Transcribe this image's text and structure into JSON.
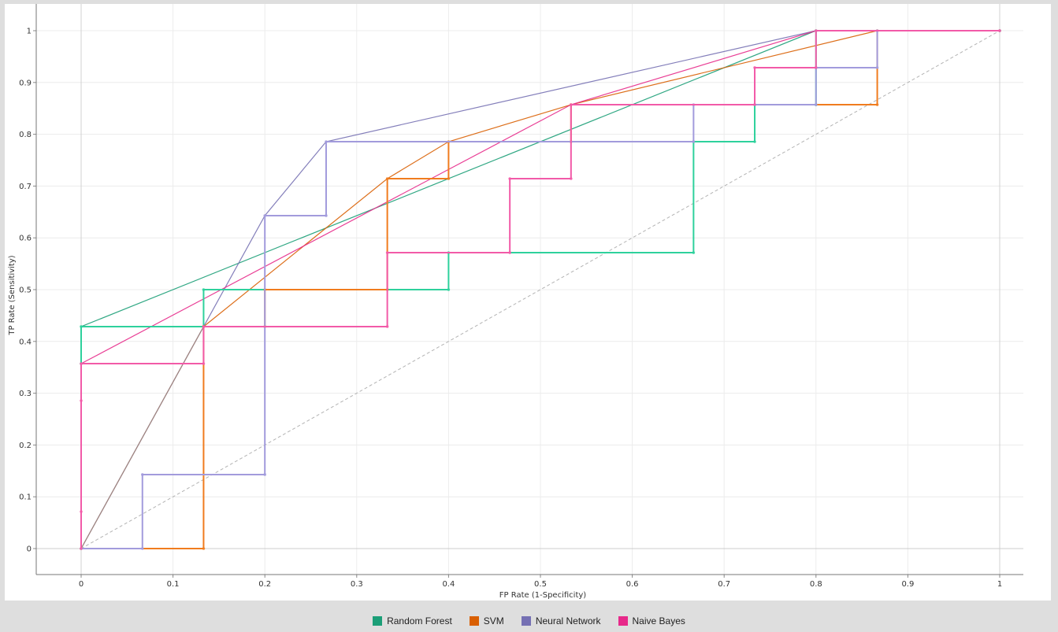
{
  "chart_data": {
    "type": "line",
    "title": "",
    "xlabel": "FP Rate (1-Specificity)",
    "ylabel": "TP Rate (Sensitivity)",
    "xlim": [
      -0.05,
      1.05
    ],
    "ylim": [
      -0.05,
      1.05
    ],
    "x_ticks": [
      0,
      0.1,
      0.2,
      0.3,
      0.4,
      0.5,
      0.6,
      0.7,
      0.8,
      0.9,
      1
    ],
    "y_ticks": [
      0,
      0.1,
      0.2,
      0.3,
      0.4,
      0.5,
      0.6,
      0.7,
      0.8,
      0.9,
      1
    ],
    "grid": true,
    "legend_position": "bottom-center",
    "diagonal": {
      "x": [
        0,
        1
      ],
      "y": [
        0,
        1
      ],
      "color": "#b3b3b3"
    },
    "series": [
      {
        "name": "Random Forest",
        "color": "#1b9e77",
        "step_color": "#2ed19c",
        "x": [
          0,
          0,
          0.1333,
          0.1333,
          0.4,
          0.4,
          0.6667,
          0.6667,
          0.7333,
          0.7333,
          0.8,
          0.8,
          1
        ],
        "y": [
          0.3571,
          0.4286,
          0.4286,
          0.5,
          0.5,
          0.5714,
          0.5714,
          0.7857,
          0.7857,
          0.8571,
          0.8571,
          1,
          1
        ],
        "hull_x": [
          0,
          0.4,
          0.8,
          1
        ],
        "hull_y": [
          0.4286,
          0.7143,
          1,
          1
        ]
      },
      {
        "name": "SVM",
        "color": "#d95f02",
        "step_color": "#f07c1e",
        "x": [
          0,
          0.1333,
          0.1333,
          0.2,
          0.2,
          0.3333,
          0.3333,
          0.4,
          0.4,
          0.5333,
          0.5333,
          0.8667,
          0.8667,
          1
        ],
        "y": [
          0,
          0,
          0.4286,
          0.4286,
          0.5,
          0.5,
          0.7143,
          0.7143,
          0.7857,
          0.7857,
          0.8571,
          0.8571,
          1,
          1
        ],
        "hull_x": [
          0.1333,
          0.3333,
          0.4,
          0.5333,
          0.8667,
          1
        ],
        "hull_y": [
          0.4286,
          0.7143,
          0.7857,
          0.8571,
          1,
          1
        ]
      },
      {
        "name": "Neural Network",
        "color": "#7570b3",
        "step_color": "#a29bdc",
        "x": [
          0,
          0.0667,
          0.0667,
          0.2,
          0.2,
          0.2667,
          0.2667,
          0.6667,
          0.6667,
          0.8,
          0.8,
          0.8667,
          0.8667,
          1
        ],
        "y": [
          0,
          0,
          0.1429,
          0.1429,
          0.6429,
          0.6429,
          0.7857,
          0.7857,
          0.8571,
          0.8571,
          0.9286,
          0.9286,
          1,
          1
        ],
        "hull_x": [
          0,
          0.2,
          0.2667,
          0.8,
          1
        ],
        "hull_y": [
          0,
          0.6429,
          0.7857,
          1,
          1
        ]
      },
      {
        "name": "Naive Bayes",
        "color": "#e7298a",
        "step_color": "#f25aa8",
        "x": [
          0,
          0,
          0,
          0,
          0.1333,
          0.1333,
          0.3333,
          0.3333,
          0.4667,
          0.4667,
          0.5333,
          0.5333,
          0.7333,
          0.7333,
          0.8,
          0.8,
          1
        ],
        "y": [
          0,
          0.0714,
          0.2857,
          0.3571,
          0.3571,
          0.4286,
          0.4286,
          0.5714,
          0.5714,
          0.7143,
          0.7143,
          0.8571,
          0.8571,
          0.9286,
          0.9286,
          1,
          1
        ],
        "hull_x": [
          0,
          0.5333,
          0.8,
          1
        ],
        "hull_y": [
          0.3571,
          0.8571,
          1,
          1
        ]
      }
    ],
    "extra_line": {
      "x": [
        0,
        0.1333
      ],
      "y": [
        0,
        0.4286
      ],
      "color": "#a1857c"
    }
  }
}
